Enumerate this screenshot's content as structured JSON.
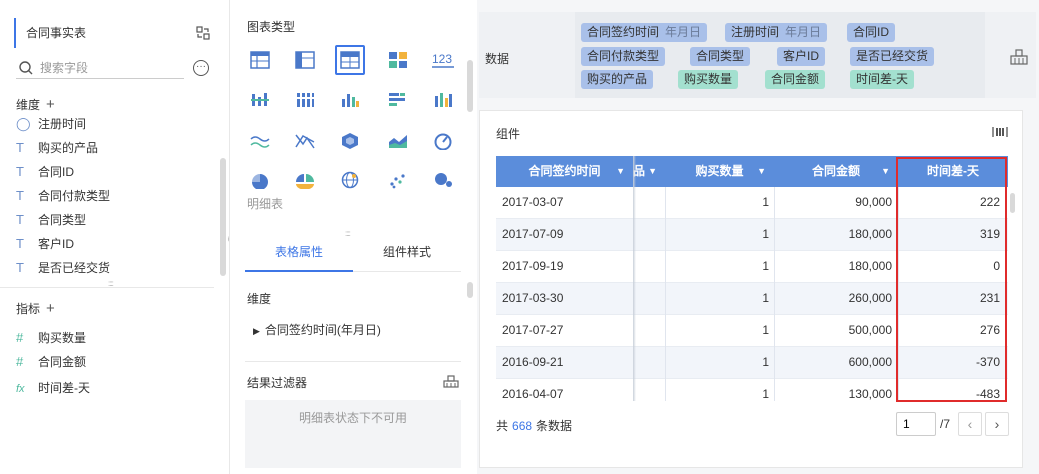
{
  "left": {
    "dataset_title": "合同事实表",
    "search_placeholder": "搜索字段",
    "dimensions_label": "维度",
    "dimension_fields": [
      "注册时间",
      "购买的产品",
      "合同ID",
      "合同付款类型",
      "合同类型",
      "客户ID",
      "是否已经交货"
    ],
    "measures_label": "指标",
    "measure_fields": [
      {
        "label": "购买数量",
        "type": "number"
      },
      {
        "label": "合同金额",
        "type": "number"
      },
      {
        "label": "时间差-天",
        "type": "formula"
      }
    ]
  },
  "mid": {
    "chart_type_title": "图表类型",
    "chart_type_icons": [
      "table-icon",
      "cross-table-icon",
      "detail-table-icon",
      "kpi-grid-icon",
      "number-123-icon",
      "grouped-bar-icon",
      "stacked-column-icon",
      "column-icon",
      "bar-icon",
      "bar-split-icon",
      "line-wave-icon",
      "line-cross-icon",
      "cube-icon",
      "area-icon",
      "gauge-icon",
      "pie-icon",
      "pie-split-icon",
      "globe-icon",
      "scatter-icon",
      "bubble-icon"
    ],
    "selected_chart_type": "明细表",
    "tab_table": "表格属性",
    "tab_style": "组件样式",
    "dimension_label": "维度",
    "dimension_item": "合同签约时间(年月日)",
    "filter_title": "结果过滤器",
    "filter_disabled_text": "明细表状态下不可用"
  },
  "right": {
    "data_label": "数据",
    "fields": [
      {
        "label": "合同签约时间",
        "granularity": "年月日",
        "color": "blue"
      },
      {
        "label": "注册时间",
        "granularity": "年月日",
        "color": "blue"
      },
      {
        "label": "合同ID",
        "color": "blue"
      },
      {
        "label": "合同付款类型",
        "color": "blue"
      },
      {
        "label": "合同类型",
        "color": "blue"
      },
      {
        "label": "客户ID",
        "color": "blue"
      },
      {
        "label": "是否已经交货",
        "color": "blue"
      },
      {
        "label": "购买的产品",
        "color": "blue"
      },
      {
        "label": "购买数量",
        "color": "green"
      },
      {
        "label": "合同金额",
        "color": "green"
      },
      {
        "label": "时间差-天",
        "color": "green"
      }
    ],
    "widget_title": "组件",
    "table": {
      "headers": [
        "合同签约时间",
        "品",
        "购买数量",
        "合同金额",
        "时间差-天"
      ],
      "rows": [
        [
          "2017-03-07",
          "",
          "1",
          "90,000",
          "222"
        ],
        [
          "2017-07-09",
          "",
          "1",
          "180,000",
          "319"
        ],
        [
          "2017-09-19",
          "",
          "1",
          "180,000",
          "0"
        ],
        [
          "2017-03-30",
          "",
          "1",
          "260,000",
          "231"
        ],
        [
          "2017-07-27",
          "",
          "1",
          "500,000",
          "276"
        ],
        [
          "2016-09-21",
          "",
          "1",
          "600,000",
          "-370"
        ],
        [
          "2016-04-07",
          "",
          "1",
          "130,000",
          "-483"
        ]
      ]
    },
    "footer": {
      "prefix": "共",
      "count": "668",
      "suffix": "条数据",
      "page_value": "1",
      "page_total": "/7"
    }
  },
  "colors": {
    "accent": "#3d76e6",
    "header_bg": "#5b8ddb",
    "highlight_border": "#e02b2b",
    "dimension_pill": "#a9c0e9",
    "measure_pill": "#a3e0cf"
  }
}
